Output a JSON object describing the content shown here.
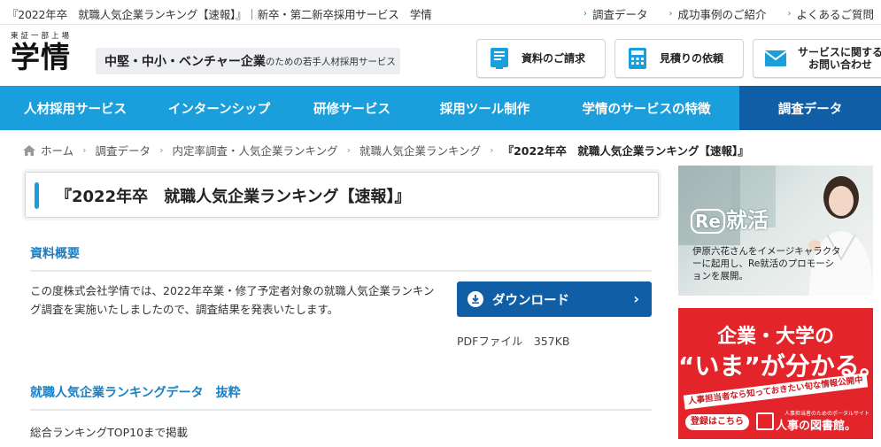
{
  "topbar": {
    "title": "『2022年卒　就職人気企業ランキング【速報】』｜新卒・第二新卒採用サービス　学情",
    "links": [
      "調査データ",
      "成功事例のご紹介",
      "よくあるご質問"
    ]
  },
  "header": {
    "logo_small": "東証一部上場",
    "logo_main": "学情",
    "tagline_strong": "中堅・中小・ベンチャー企業",
    "tagline_rest": "のための若手人材採用サービス",
    "buttons": [
      {
        "label": "資料のご請求",
        "icon": "document-icon"
      },
      {
        "label": "見積りの依頼",
        "icon": "calculator-icon"
      },
      {
        "label_1": "サービスに関する",
        "label_2": "お問い合わせ",
        "icon": "mail-icon"
      }
    ]
  },
  "nav": {
    "items": [
      "人材採用サービス",
      "インターンシップ",
      "研修サービス",
      "採用ツール制作",
      "学情のサービスの特徴",
      "調査データ"
    ],
    "active": "調査データ"
  },
  "breadcrumb": [
    "ホーム",
    "調査データ",
    "内定率調査・人気企業ランキング",
    "就職人気企業ランキング",
    "『2022年卒　就職人気企業ランキング【速報】』"
  ],
  "page_title": "『2022年卒　就職人気企業ランキング【速報】』",
  "overview": {
    "heading": "資料概要",
    "text": "この度株式会社学情では、2022年卒業・修了予定者対象の就職人気企業ランキング調査を実施いたしましたので、調査結果を発表いたします。",
    "download_label": "ダウンロード",
    "file_info": "PDFファイル　357KB"
  },
  "ranking": {
    "heading": "就職人気企業ランキングデータ　抜粋",
    "text": "総合ランキングTOP10まで掲載"
  },
  "banner_reshukatsu": {
    "logo_re": "Re",
    "logo_rest": "就活",
    "text": "伊原六花さんをイメージキャラクターに起用し、Re就活のプロモーションを展開。"
  },
  "banner_library": {
    "line1": "企業・大学の",
    "line2": "“いま”が分かる。",
    "ribbon": "人事担当者なら知っておきたい旬な情報公開中",
    "button": "登録はこちら",
    "sub": "人事担当者のためのポータルサイト",
    "brand": "人事の図書館。"
  },
  "colors": {
    "nav_bg": "#1a9fdc",
    "nav_active": "#0f5ea6",
    "heading_blue": "#1a7fc4",
    "banner_red": "#e3242b"
  }
}
